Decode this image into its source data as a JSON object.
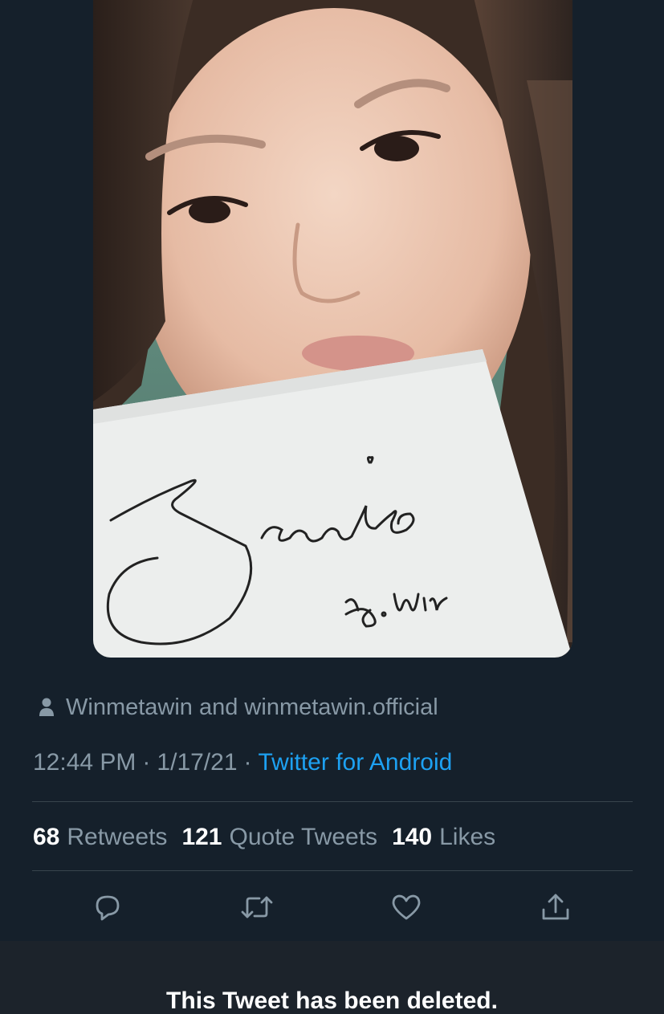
{
  "tweet": {
    "photo": {
      "description_icon": "photo-image",
      "note_text": [
        "Jennie",
        "to.Win"
      ]
    },
    "tagged_icon": "person-icon",
    "tagged_users": "Winmetawin and winmetawin.official",
    "time": "12:44 PM",
    "separator": "·",
    "date": "1/17/21",
    "source": "Twitter for Android",
    "stats": [
      {
        "count": "68",
        "label": "Retweets"
      },
      {
        "count": "121",
        "label": "Quote Tweets"
      },
      {
        "count": "140",
        "label": "Likes"
      }
    ],
    "actions": [
      "reply-icon",
      "retweet-icon",
      "like-icon",
      "share-icon"
    ]
  },
  "deleted_notice": "This Tweet has been deleted.",
  "colors": {
    "background": "#15202b",
    "secondary_text": "#8899a6",
    "link": "#1da1f2",
    "divider": "#38444d",
    "banner": "#1c232b"
  }
}
